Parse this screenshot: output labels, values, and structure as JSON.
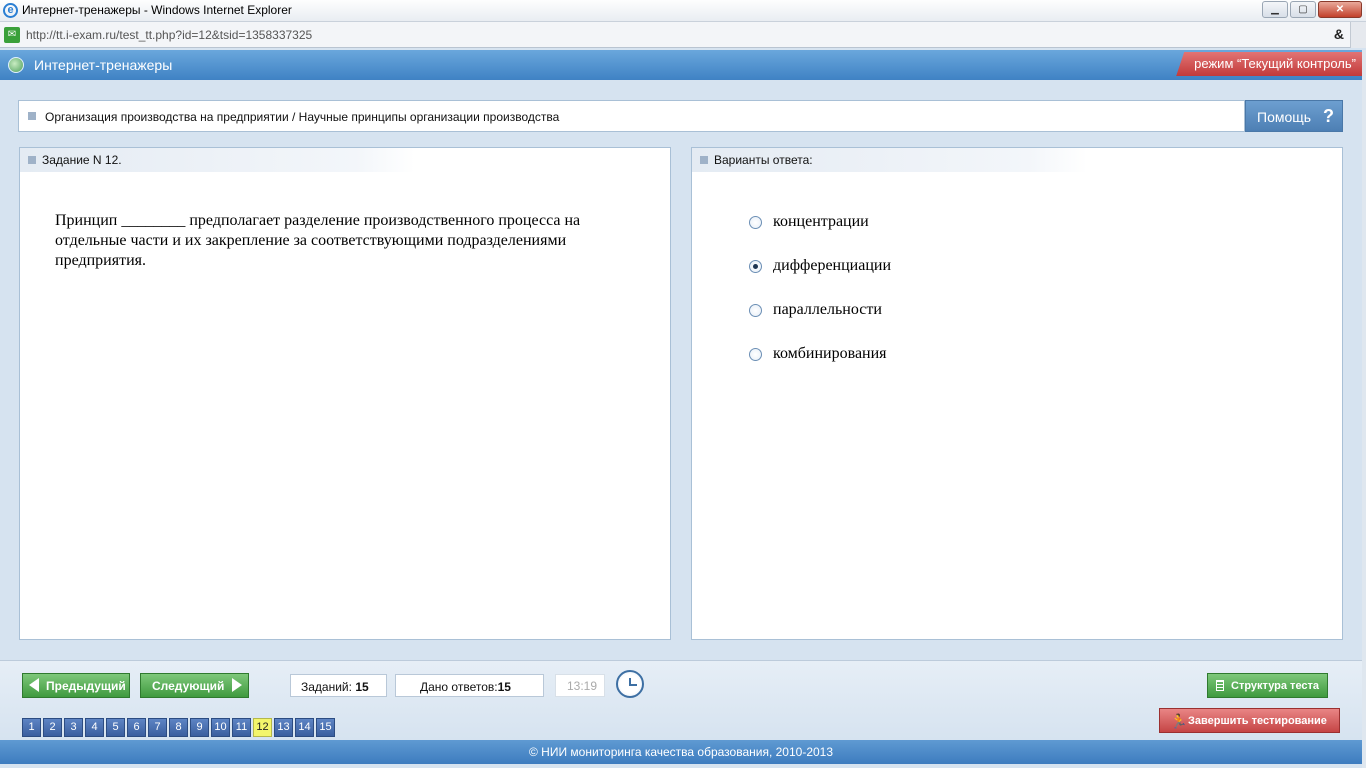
{
  "window": {
    "title": "Интернет-тренажеры - Windows Internet Explorer"
  },
  "browser": {
    "url": "http://tt.i-exam.ru/test_tt.php?id=12&tsid=1358337325"
  },
  "app": {
    "title": "Интернет-тренажеры",
    "mode": "режим “Текущий контроль”"
  },
  "breadcrumb": "Организация производства на предприятии / Научные принципы организации производства",
  "help_label": "Помощь",
  "task": {
    "header": "Задание N 12.",
    "text": "Принцип ________ предполагает разделение производственного процесса на отдельные части и их закрепление за соответствующими подразделениями предприятия."
  },
  "answers": {
    "header": "Варианты ответа:",
    "options": [
      {
        "label": "концентрации",
        "selected": false
      },
      {
        "label": "дифференциации",
        "selected": true
      },
      {
        "label": "параллельности",
        "selected": false
      },
      {
        "label": "комбинирования",
        "selected": false
      }
    ]
  },
  "nav": {
    "prev": "Предыдущий",
    "next": "Следующий"
  },
  "stats": {
    "tasks_label": "Заданий:",
    "tasks_value": "15",
    "answered_label": "Дано ответов:",
    "answered_value": "15",
    "timer": "13:19"
  },
  "structure_label": "Структура теста",
  "finish_label": "Завершить тестирование",
  "pages": [
    "1",
    "2",
    "3",
    "4",
    "5",
    "6",
    "7",
    "8",
    "9",
    "10",
    "11",
    "12",
    "13",
    "14",
    "15"
  ],
  "current_page": "12",
  "footer": "© НИИ мониторинга качества образования, 2010-2013"
}
